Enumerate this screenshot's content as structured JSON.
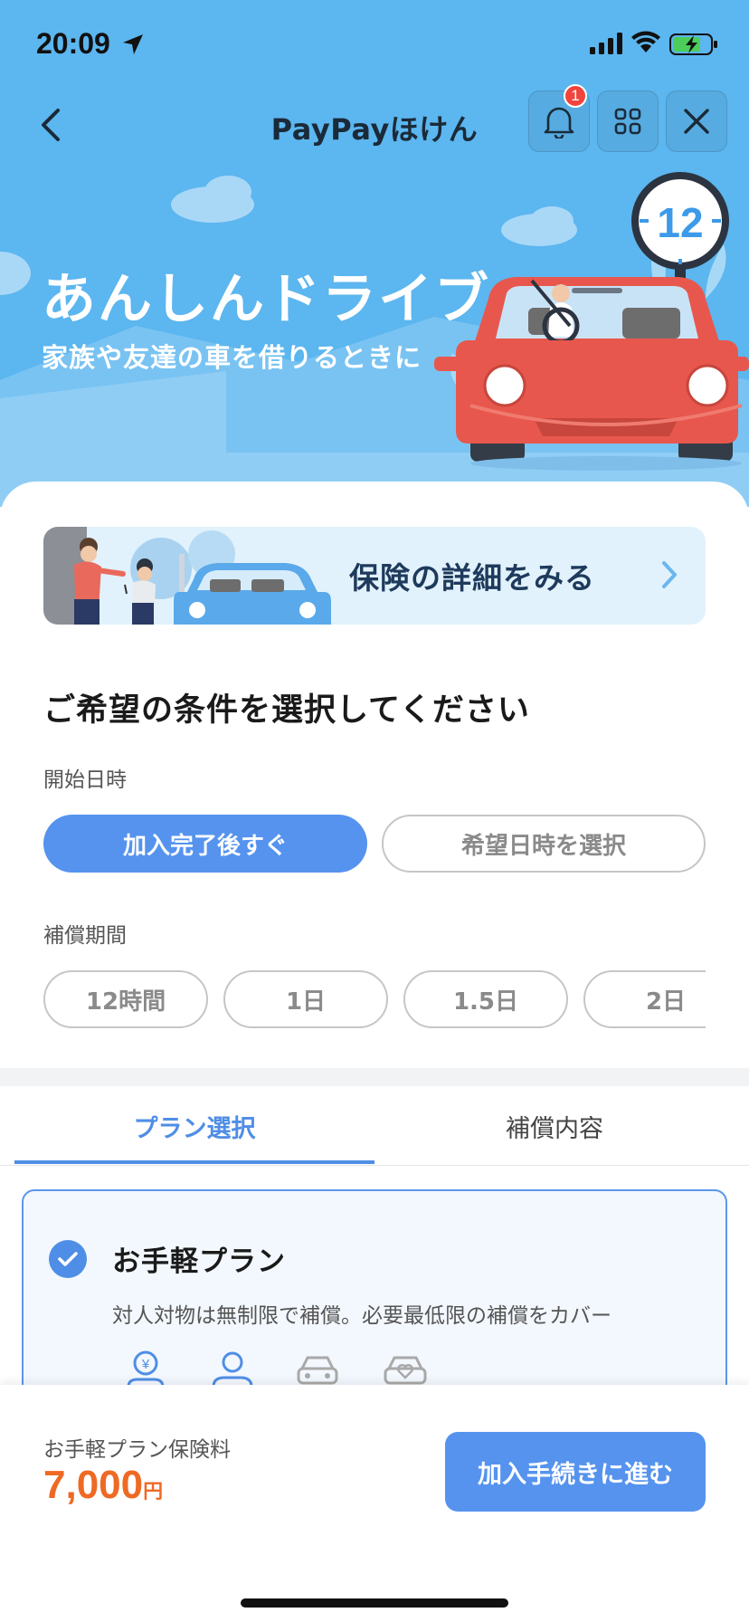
{
  "status_bar": {
    "time": "20:09"
  },
  "header": {
    "title": "PayPayほけん",
    "notification_count": "1"
  },
  "hero": {
    "title": "あんしんドライブ",
    "subtitle": "家族や友達の車を借りるときに",
    "clock_number": "12"
  },
  "detail_banner": {
    "label": "保険の詳細をみる"
  },
  "conditions": {
    "heading": "ご希望の条件を選択してください",
    "start_label": "開始日時",
    "start_options": [
      "加入完了後すぐ",
      "希望日時を選択"
    ],
    "start_selected": "加入完了後すぐ",
    "period_label": "補償期間",
    "period_options": [
      "12時間",
      "1日",
      "1.5日",
      "2日"
    ]
  },
  "tabs": [
    {
      "label": "プラン選択",
      "active": true
    },
    {
      "label": "補償内容",
      "active": false
    }
  ],
  "plan": {
    "name": "お手軽プラン",
    "description": "対人対物は無制限で補償。必要最低限の補償をカバー",
    "selected": true,
    "icons": [
      "yen-person-icon",
      "person-icon",
      "car-icon",
      "car-heart-icon"
    ]
  },
  "footer": {
    "price_label": "お手軽プラン保険料",
    "price": "7,000",
    "price_unit": "円",
    "cta_label": "加入手続きに進む"
  },
  "colors": {
    "hero_blue": "#5cb6ef",
    "primary": "#5593ee",
    "price_orange": "#ee6a24",
    "car_red": "#e8574d"
  }
}
